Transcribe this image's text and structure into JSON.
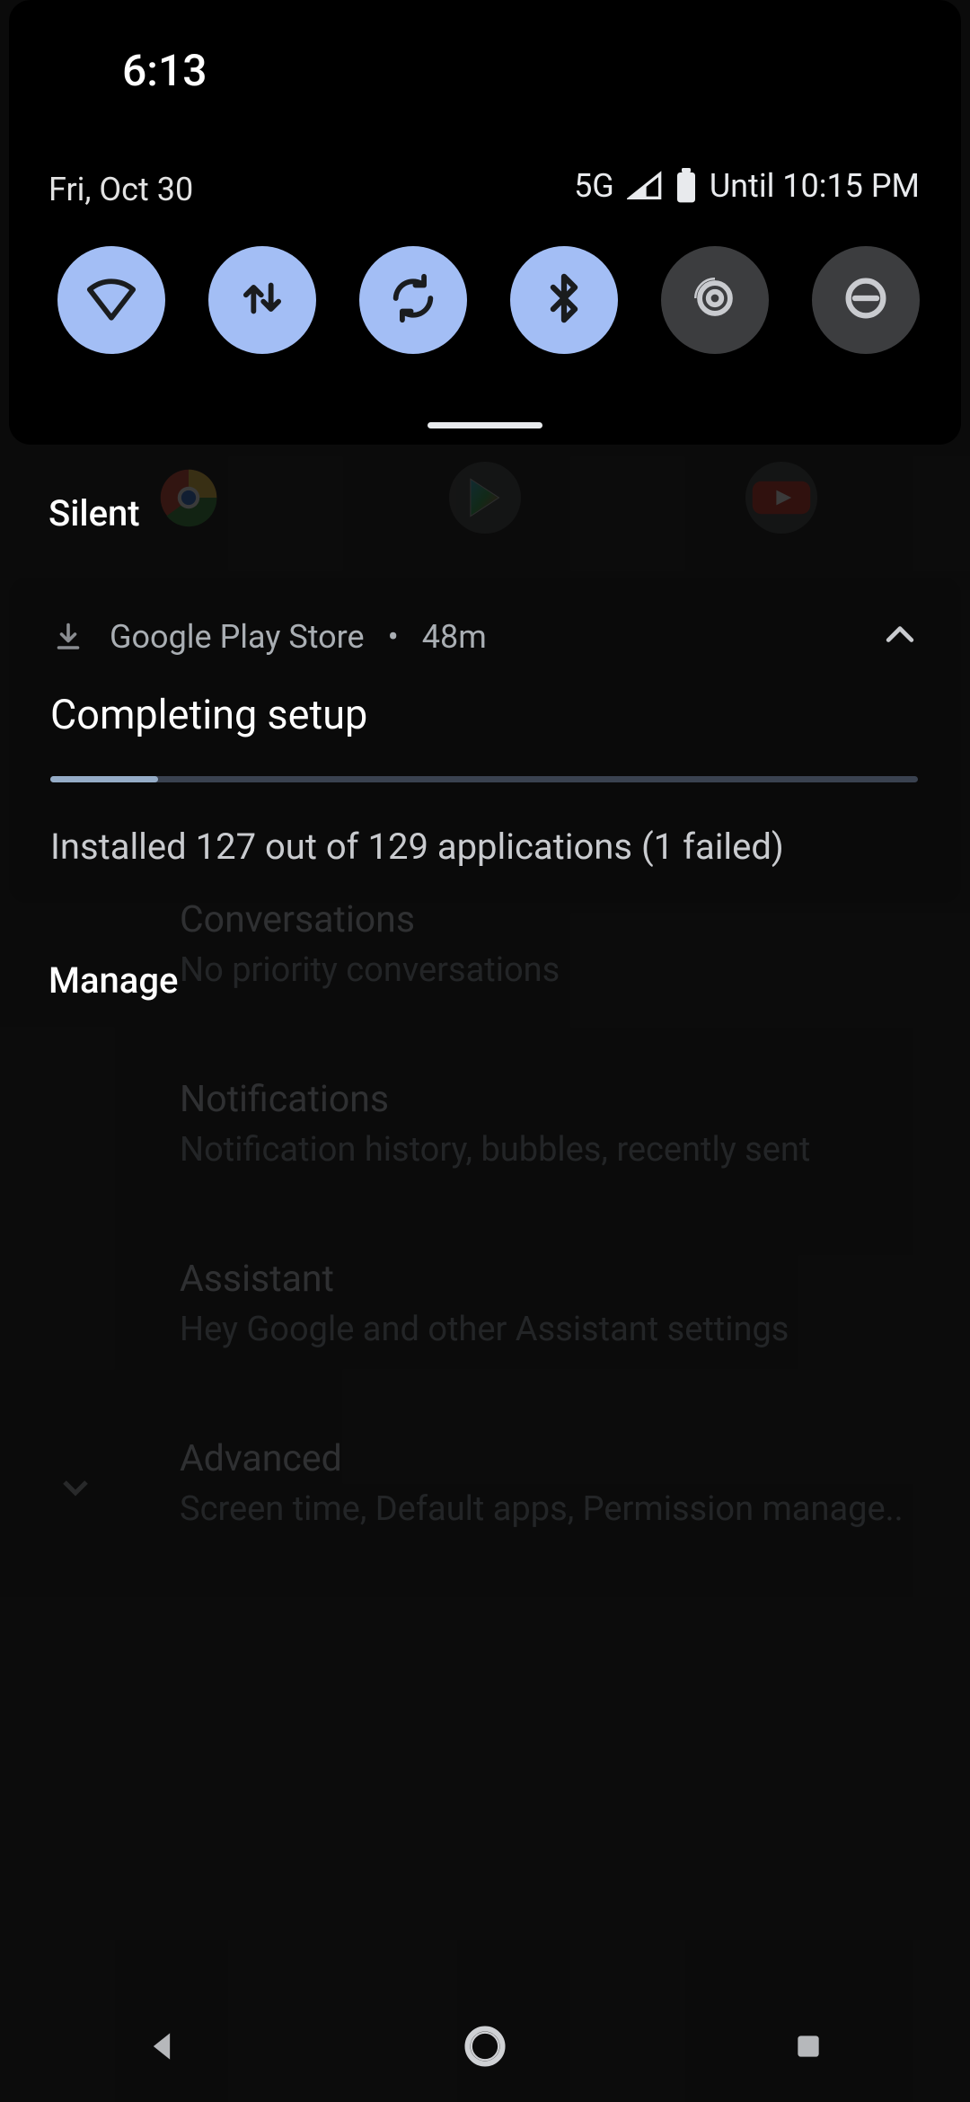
{
  "status": {
    "clock": "6:13",
    "date": "Fri, Oct 30",
    "network_label": "5G",
    "battery_until": "Until 10:15 PM"
  },
  "tiles": [
    {
      "name": "wifi",
      "active": true
    },
    {
      "name": "mobile-data",
      "active": true
    },
    {
      "name": "auto-rotate",
      "active": true
    },
    {
      "name": "bluetooth",
      "active": true
    },
    {
      "name": "screen-cast",
      "active": false
    },
    {
      "name": "dnd",
      "active": false
    }
  ],
  "shade": {
    "section_silent": "Silent",
    "manage_label": "Manage"
  },
  "notification": {
    "app": "Google Play Store",
    "age": "48m",
    "title": "Completing setup",
    "progress_pct": 12.4,
    "body": "Installed 127 out of 129 applications (1 failed)"
  },
  "background_settings": {
    "rows": [
      {
        "title": "Conversations",
        "sub": "No priority conversations"
      },
      {
        "title": "Notifications",
        "sub": "Notification history, bubbles, recently sent"
      },
      {
        "title": "Assistant",
        "sub": "Hey Google and other Assistant settings"
      },
      {
        "title": "Advanced",
        "sub": "Screen time, Default apps, Permission manage.."
      }
    ],
    "app_shortcuts": [
      "chrome",
      "play-store",
      "youtube"
    ]
  },
  "colors": {
    "tile_active_bg": "#a3bef5",
    "tile_inactive_bg": "#3c3d3f",
    "accent_progress": "#95acc7"
  }
}
